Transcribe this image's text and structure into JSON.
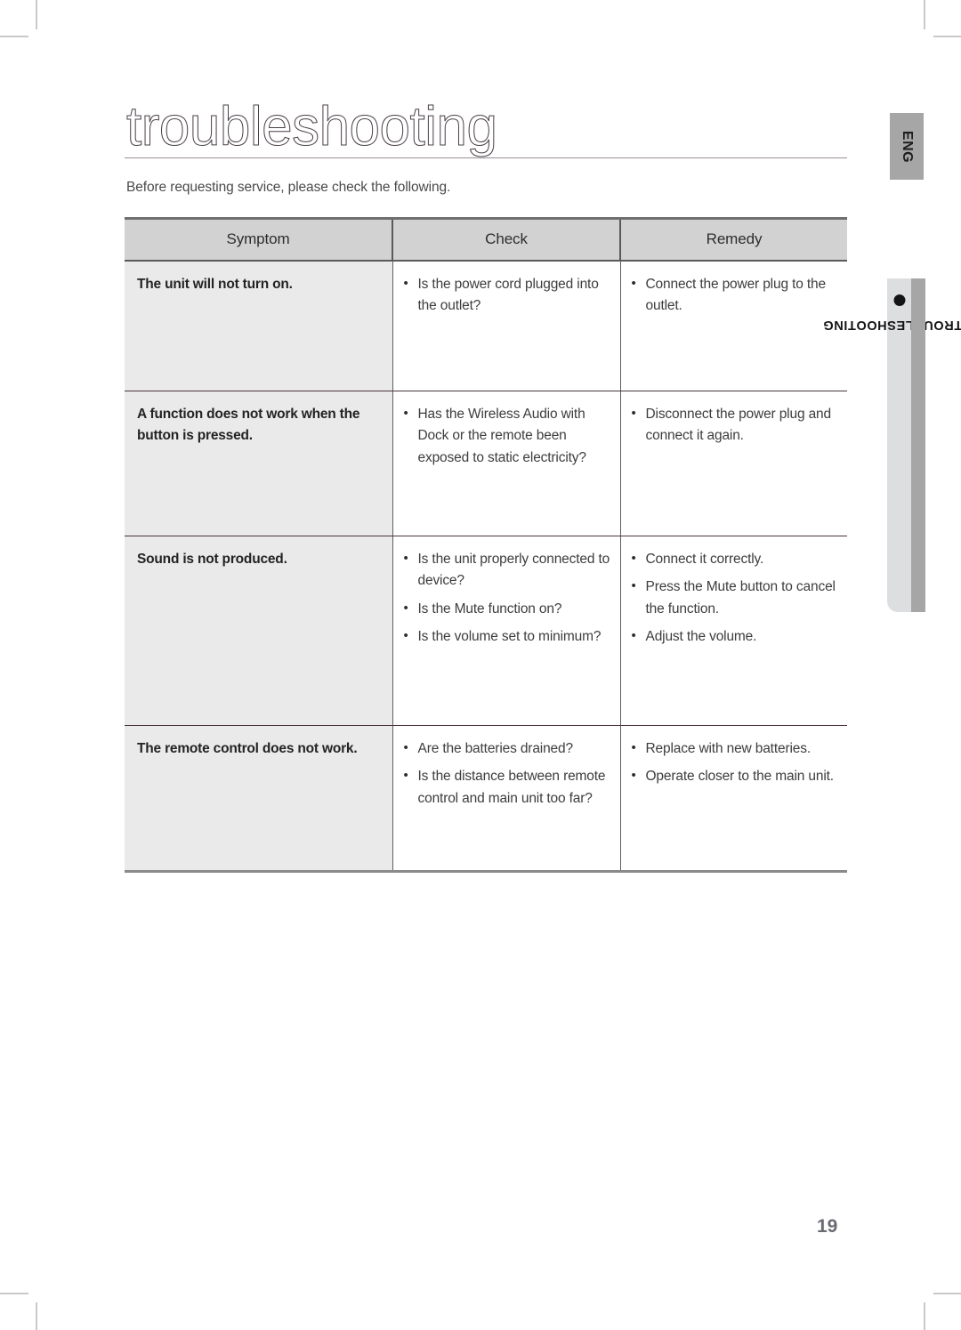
{
  "document": {
    "title": "troubleshooting",
    "intro": "Before requesting service, please check the following.",
    "page_number": "19"
  },
  "side_tabs": {
    "language": "ENG",
    "section": "TROUBLESHOOTING"
  },
  "colors": {
    "header_fill": "#d2d2d2",
    "symptom_fill": "#eaeaea",
    "tab_gray": "#a6a6a6",
    "tab_light": "#dcdee0",
    "rule": "#9a9098",
    "page_number": "#6a6a74"
  },
  "table": {
    "headers": [
      "Symptom",
      "Check",
      "Remedy"
    ],
    "rows": [
      {
        "symptom": "The unit will not turn on.",
        "check": [
          "Is the power cord plugged into the outlet?"
        ],
        "remedy": [
          "Connect the power plug to the outlet."
        ]
      },
      {
        "symptom": "A function does not work when the button is pressed.",
        "check": [
          "Has the Wireless Audio with Dock or the remote been exposed to static electricity?"
        ],
        "remedy": [
          "Disconnect the power plug and connect it again."
        ]
      },
      {
        "symptom": "Sound is not produced.",
        "check": [
          "Is the unit properly connected to device?",
          "Is the Mute function on?",
          "Is the volume set to minimum?"
        ],
        "remedy": [
          "Connect it correctly.",
          "Press the Mute button to cancel the function.",
          "Adjust the volume."
        ]
      },
      {
        "symptom": "The remote control does not work.",
        "check": [
          "Are the batteries drained?",
          "Is the distance between remote control and main unit too far?"
        ],
        "remedy": [
          "Replace with new batteries.",
          "Operate closer to the main unit."
        ]
      }
    ]
  }
}
